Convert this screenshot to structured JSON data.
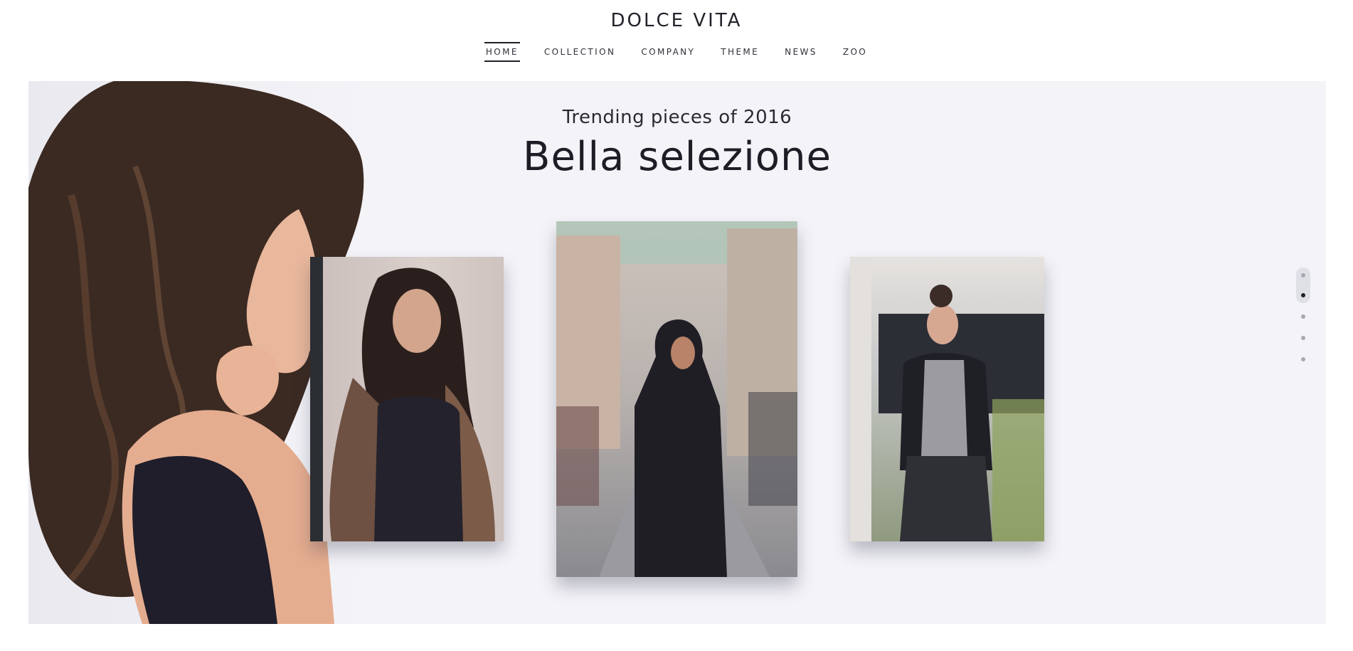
{
  "brand": "DOLCE VITA",
  "nav": [
    {
      "label": "HOME",
      "active": true
    },
    {
      "label": "COLLECTION",
      "active": false
    },
    {
      "label": "COMPANY",
      "active": false
    },
    {
      "label": "THEME",
      "active": false
    },
    {
      "label": "NEWS",
      "active": false
    },
    {
      "label": "ZOO",
      "active": false
    }
  ],
  "hero": {
    "subtitle": "Trending pieces of 2016",
    "title": "Bella selezione",
    "background": "#f3f3f8"
  },
  "slider": {
    "dot_count": 5,
    "active_index": 1
  },
  "colors": {
    "text_dark": "#1d1d26",
    "accent": "#1f1f27"
  }
}
